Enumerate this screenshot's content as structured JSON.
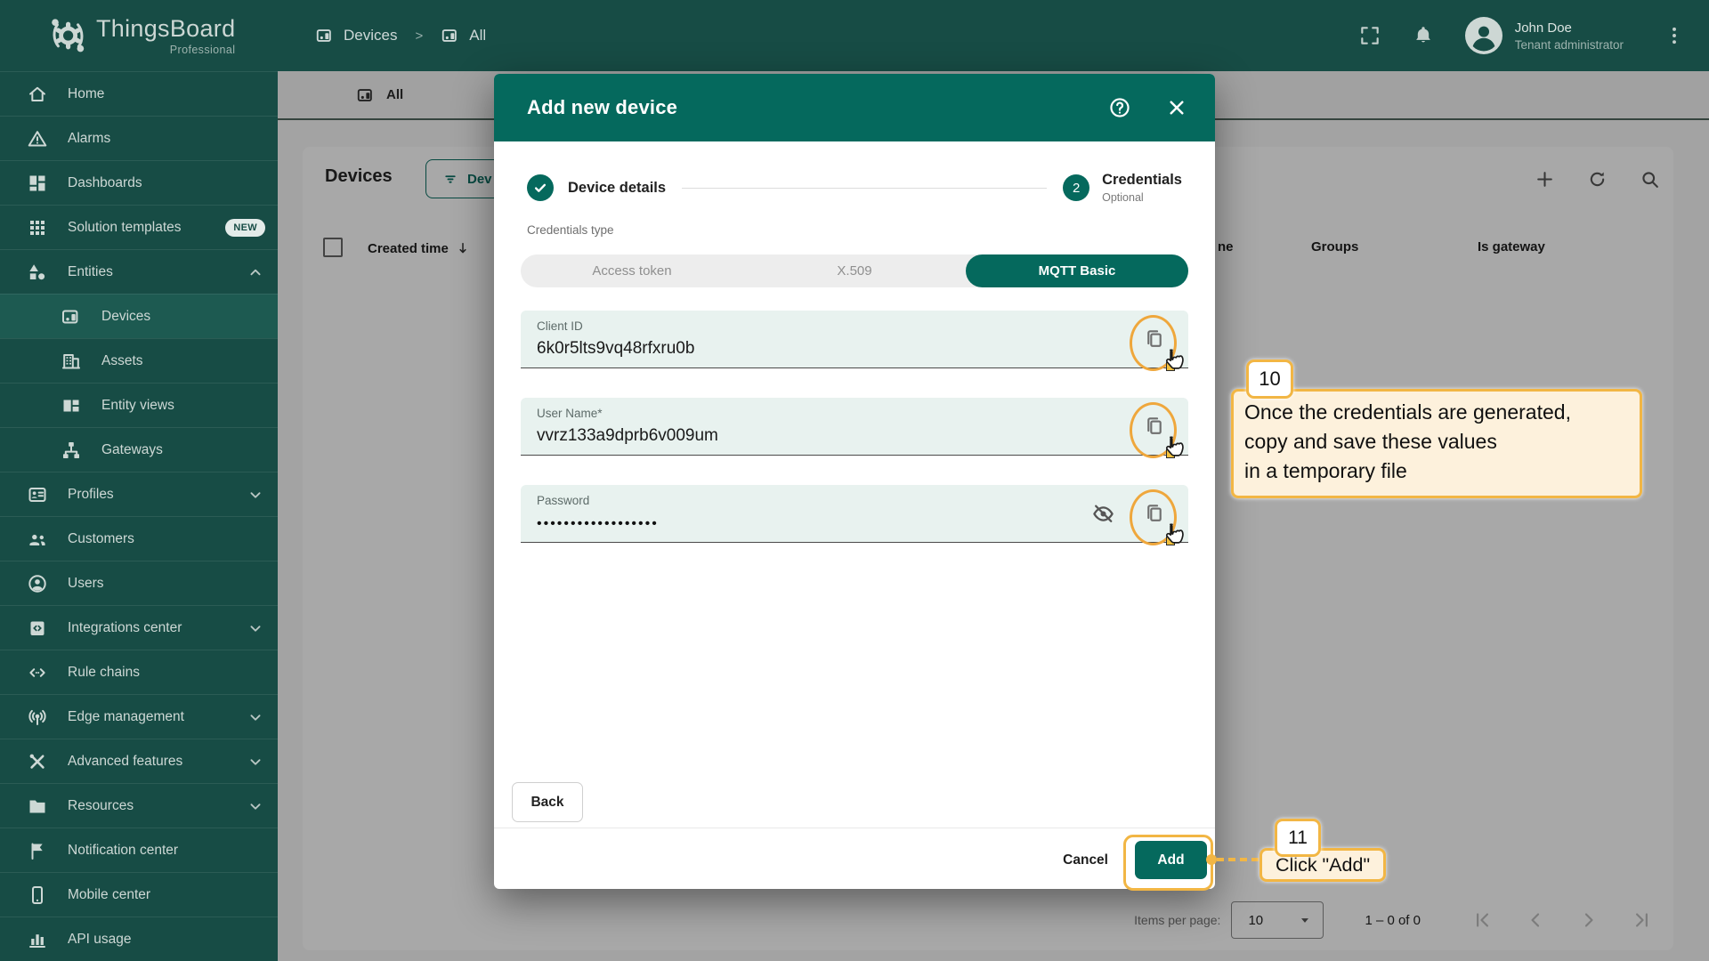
{
  "brand": {
    "name": "ThingsBoard",
    "subtitle": "Professional",
    "logo_icon": "gear-logo-icon"
  },
  "topbar": {
    "breadcrumb": [
      {
        "label": "Devices",
        "icon": "devices-icon"
      },
      {
        "label": "All",
        "icon": "devices-icon"
      }
    ],
    "separator": ">",
    "icons": [
      "fullscreen-icon",
      "bell-icon",
      "kebab-icon"
    ],
    "user": {
      "name": "John Doe",
      "role": "Tenant administrator",
      "avatar_icon": "person-icon"
    }
  },
  "sidebar": {
    "items": [
      {
        "label": "Home",
        "icon": "home-icon"
      },
      {
        "label": "Alarms",
        "icon": "alarms-icon"
      },
      {
        "label": "Dashboards",
        "icon": "dashboards-icon"
      },
      {
        "label": "Solution templates",
        "icon": "solution-templates-icon",
        "badge": "NEW"
      },
      {
        "label": "Entities",
        "icon": "entities-icon",
        "chevron": "up"
      },
      {
        "label": "Devices",
        "icon": "devices-icon",
        "sub": true,
        "selected": true
      },
      {
        "label": "Assets",
        "icon": "assets-icon",
        "sub": true
      },
      {
        "label": "Entity views",
        "icon": "entity-views-icon",
        "sub": true
      },
      {
        "label": "Gateways",
        "icon": "gateways-icon",
        "sub": true
      },
      {
        "label": "Profiles",
        "icon": "profiles-icon",
        "chevron": "down"
      },
      {
        "label": "Customers",
        "icon": "customers-icon"
      },
      {
        "label": "Users",
        "icon": "users-icon"
      },
      {
        "label": "Integrations center",
        "icon": "integrations-center-icon",
        "chevron": "down"
      },
      {
        "label": "Rule chains",
        "icon": "rule-chains-icon"
      },
      {
        "label": "Edge management",
        "icon": "edge-management-icon",
        "chevron": "down"
      },
      {
        "label": "Advanced features",
        "icon": "advanced-features-icon",
        "chevron": "down"
      },
      {
        "label": "Resources",
        "icon": "resources-icon",
        "chevron": "down"
      },
      {
        "label": "Notification center",
        "icon": "notification-center-icon"
      },
      {
        "label": "Mobile center",
        "icon": "mobile-center-icon"
      },
      {
        "label": "API usage",
        "icon": "api-usage-icon"
      }
    ]
  },
  "content": {
    "tab": {
      "label": "All",
      "icon": "devices-icon"
    },
    "page_title": "Devices",
    "filter_button_label": "Dev",
    "action_icons": [
      "plus-icon",
      "refresh-icon",
      "search-icon"
    ],
    "table": {
      "headers": {
        "created_time": "Created time",
        "name_partial": "ne",
        "groups": "Groups",
        "is_gateway": "Is gateway"
      }
    },
    "pagination": {
      "items_per_page_label": "Items per page:",
      "per_page": "10",
      "range": "1 – 0 of 0"
    }
  },
  "dialog": {
    "title": "Add new device",
    "steps": {
      "step1": "Device details",
      "step2_number": "2",
      "step2": "Credentials",
      "step2_hint": "Optional"
    },
    "credentials_type_label": "Credentials type",
    "tabs": [
      {
        "label": "Access token"
      },
      {
        "label": "X.509"
      },
      {
        "label": "MQTT Basic",
        "selected": true
      }
    ],
    "fields": {
      "client_id": {
        "label": "Client ID",
        "value": "6k0r5lts9vq48rfxru0b"
      },
      "user_name": {
        "label": "User Name*",
        "value": "vvrz133a9dprb6v009um"
      },
      "password": {
        "label": "Password",
        "value": "••••••••••••••••••"
      }
    },
    "buttons": {
      "back": "Back",
      "cancel": "Cancel",
      "add": "Add"
    }
  },
  "annotations": {
    "step10": {
      "number": "10",
      "text_lines": [
        "Once the credentials are generated,",
        "copy and save these values",
        "in a temporary file"
      ]
    },
    "step11": {
      "number": "11",
      "text": "Click \"Add\""
    }
  },
  "colors": {
    "accent_teal": "#05695d",
    "sidebar_bg": "#174c45",
    "selected_item_bg": "#1d5a51",
    "highlight_amber": "#f2b644",
    "ring_amber": "#efa73c",
    "field_mint_bg": "#e8f2ef",
    "annotation_bg": "#fdf1dc"
  }
}
